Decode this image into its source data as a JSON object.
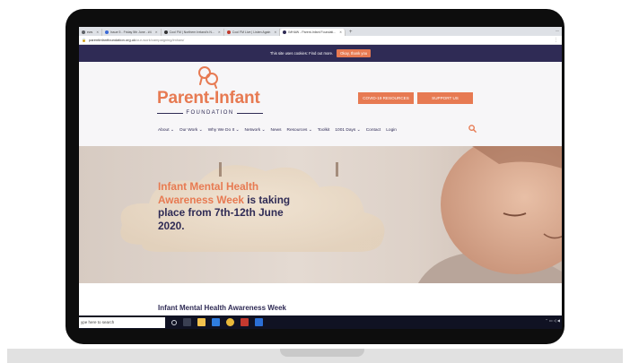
{
  "browser": {
    "tabs": [
      {
        "label": "ews",
        "active": false
      },
      {
        "label": "Issue 5 - Friday 5th June - #4",
        "active": false
      },
      {
        "label": "Cool FM | Northern Ireland's N...",
        "active": false
      },
      {
        "label": "Cool FM Live | Listen Again",
        "active": false
      },
      {
        "label": "IMHAW - Parent-Infant Foundati...",
        "active": true
      }
    ],
    "new_tab": "+",
    "url_host": "parentinfantfoundation.org.uk",
    "url_path": "/our-work/campaigning/imhaw/"
  },
  "cookie_bar": {
    "text": "This site uses cookies: Find out more.",
    "button": "Okay, thank you"
  },
  "header": {
    "logo_word": "Parent-Infant",
    "logo_sub": "FOUNDATION",
    "covid_button": "COVID-19 RESOURCES",
    "support_button": "SUPPORT US",
    "nav": [
      {
        "label": "About ⌄"
      },
      {
        "label": "Our Work ⌄"
      },
      {
        "label": "Why We Do It ⌄"
      },
      {
        "label": "Network ⌄"
      },
      {
        "label": "News"
      },
      {
        "label": "Resources ⌄"
      },
      {
        "label": "Toolkit"
      },
      {
        "label": "1001 Days ⌄"
      },
      {
        "label": "Contact"
      },
      {
        "label": "Login"
      }
    ]
  },
  "hero": {
    "highlight": "Infant Mental Health Awareness Week",
    "rest": " is taking place from 7th-12th June 2020."
  },
  "section_title": "Infant Mental Health Awareness Week",
  "taskbar": {
    "search_placeholder": "ype here to search"
  },
  "colors": {
    "brand_navy": "#2f2b55",
    "brand_orange": "#e77a52"
  }
}
